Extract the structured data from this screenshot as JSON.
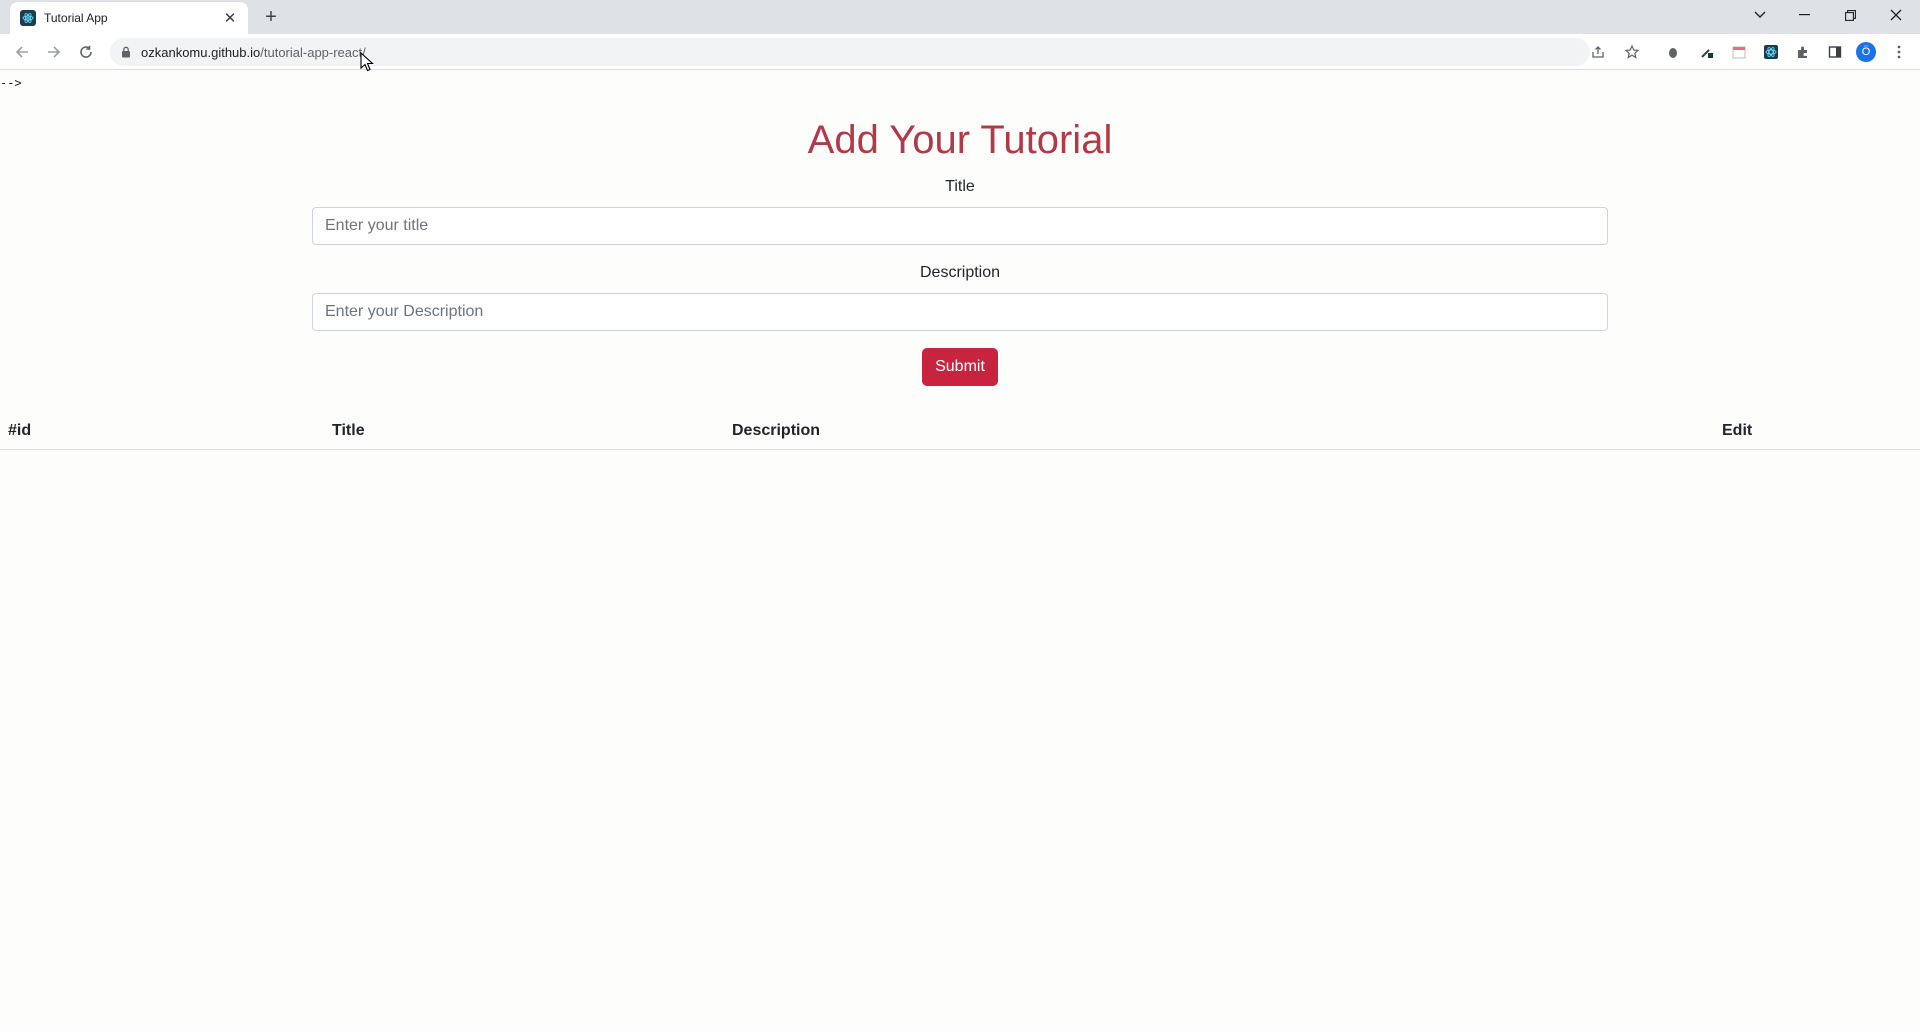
{
  "browser": {
    "tab_title": "Tutorial App",
    "url_host": "ozkankomu.github.io",
    "url_path": "/tutorial-app-react/",
    "profile_initial": "Ö"
  },
  "page": {
    "stray_text": "-->",
    "title": "Add Your Tutorial",
    "title_label": "Title",
    "title_placeholder": "Enter your title",
    "description_label": "Description",
    "description_placeholder": "Enter your Description",
    "submit_label": "Submit"
  },
  "table": {
    "headers": {
      "id": "#id",
      "title": "Title",
      "description": "Description",
      "edit": "Edit"
    },
    "rows": []
  },
  "colors": {
    "title": "#b23a48",
    "submit": "#c8233f"
  }
}
